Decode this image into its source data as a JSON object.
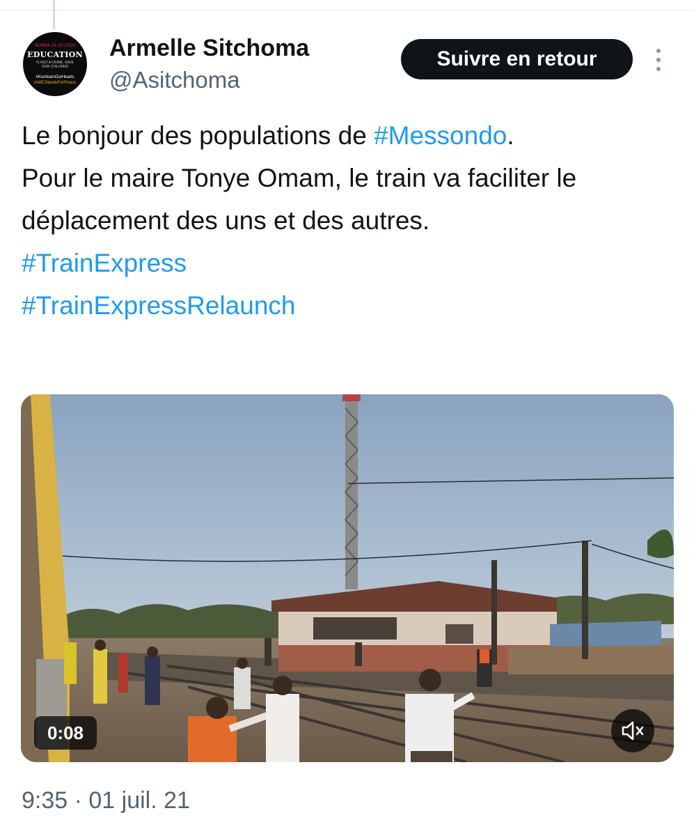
{
  "tweet": {
    "author": {
      "display_name": "Armelle Sitchoma",
      "handle": "@Asitchoma",
      "avatar": {
        "title": "EDUCATION",
        "sub": "IS NOT A CRIME. SAVE OUR CHILDREN",
        "tags": [
          "#KumbaInOurHearts",
          "#ABCStandsForPeace"
        ]
      }
    },
    "follow_label": "Suivre en retour",
    "more_icon": "more-vertical-icon",
    "text": {
      "line1_prefix": "Le bonjour des populations de ",
      "hashtag1": "#Messondo",
      "line1_suffix": ".",
      "body": "Pour le maire Tonye Omam, le train va faciliter le déplacement des uns et des autres.",
      "hashtag2": "#TrainExpress",
      "hashtag3": "#TrainExpressRelaunch"
    },
    "video": {
      "duration": "0:08",
      "mute_icon": "volume-muted-icon"
    },
    "timestamp": "9:35 · 01 juil. 21"
  },
  "colors": {
    "link": "#1d9bf0",
    "text": "#0f1419",
    "secondary": "#536471",
    "button_bg": "#0f1419"
  }
}
